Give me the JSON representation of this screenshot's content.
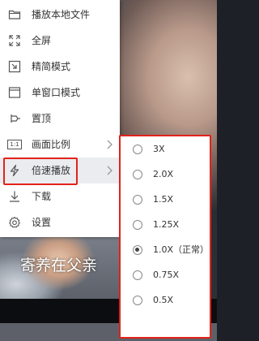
{
  "video": {
    "subtitle": "寄养在父亲"
  },
  "context_menu": {
    "items": [
      {
        "label": "播放本地文件",
        "icon": "folder-icon",
        "has_submenu": false
      },
      {
        "label": "全屏",
        "icon": "fullscreen-icon",
        "has_submenu": false
      },
      {
        "label": "精简模式",
        "icon": "compact-mode-icon",
        "has_submenu": false
      },
      {
        "label": "单窗口模式",
        "icon": "single-window-icon",
        "has_submenu": false
      },
      {
        "label": "置顶",
        "icon": "pin-icon",
        "has_submenu": false
      },
      {
        "label": "画面比例",
        "icon": "aspect-ratio-icon",
        "icon_text": "1:1",
        "has_submenu": true
      },
      {
        "label": "倍速播放",
        "icon": "lightning-icon",
        "has_submenu": true,
        "active": true
      },
      {
        "label": "下载",
        "icon": "download-icon",
        "has_submenu": false
      },
      {
        "label": "设置",
        "icon": "gear-icon",
        "has_submenu": false
      }
    ]
  },
  "speed_menu": {
    "options": [
      {
        "label": "3X",
        "selected": false
      },
      {
        "label": "2.0X",
        "selected": false
      },
      {
        "label": "1.5X",
        "selected": false
      },
      {
        "label": "1.25X",
        "selected": false
      },
      {
        "label": "1.0X（正常）",
        "selected": true
      },
      {
        "label": "0.75X",
        "selected": false
      },
      {
        "label": "0.5X",
        "selected": false
      }
    ]
  },
  "colors": {
    "highlight_border": "#e2231a",
    "active_item_bg": "#ebecef",
    "menu_bg": "#ffffff",
    "text": "#333333"
  }
}
